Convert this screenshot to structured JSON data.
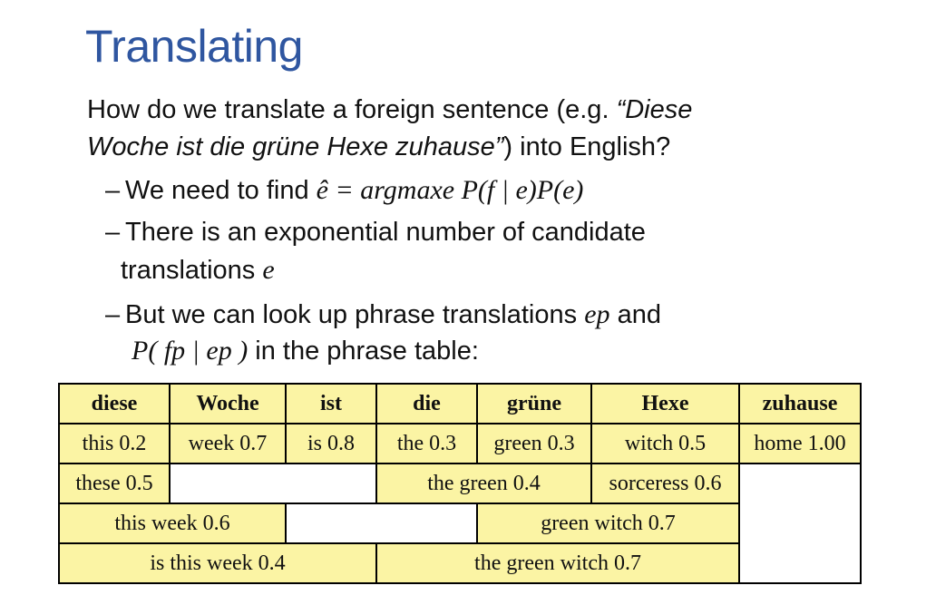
{
  "slide": {
    "title": "Translating",
    "intro_line1_a": "How do we translate a foreign sentence (e.g. ",
    "intro_line1_b": "“Diese",
    "intro_line2_a": "Woche ist die grüne Hexe zuhause”",
    "intro_line2_b": ") into English?",
    "bullet1_text": "We need to find ",
    "bullet1_math": "ê = argmaxe P(f | e)P(e)",
    "bullet2_text_1": "There is an exponential number of candidate",
    "bullet2_text_2": "translations ",
    "bullet2_math": "e",
    "bullet3_text_1": "But we can look up phrase translations ",
    "bullet3_math_1": "ep",
    "bullet3_text_2": " and",
    "bullet3_math_2": "P( fp | ep )",
    "bullet3_text_3": " in the phrase table:",
    "dash": "–"
  },
  "phrase_table": {
    "headers": [
      "diese",
      "Woche",
      "ist",
      "die",
      "grüne",
      "Hexe",
      "zuhause"
    ],
    "row1": [
      "this 0.2",
      "week 0.7",
      "is 0.8",
      "the 0.3",
      "green 0.3",
      "witch 0.5",
      "home 1.00"
    ],
    "row2": [
      "these 0.5",
      "",
      "the green 0.4",
      "sorceress 0.6"
    ],
    "row3": [
      "this week 0.6",
      "",
      "green witch 0.7"
    ],
    "row4": [
      "is this week 0.4",
      "the green witch 0.7"
    ]
  }
}
